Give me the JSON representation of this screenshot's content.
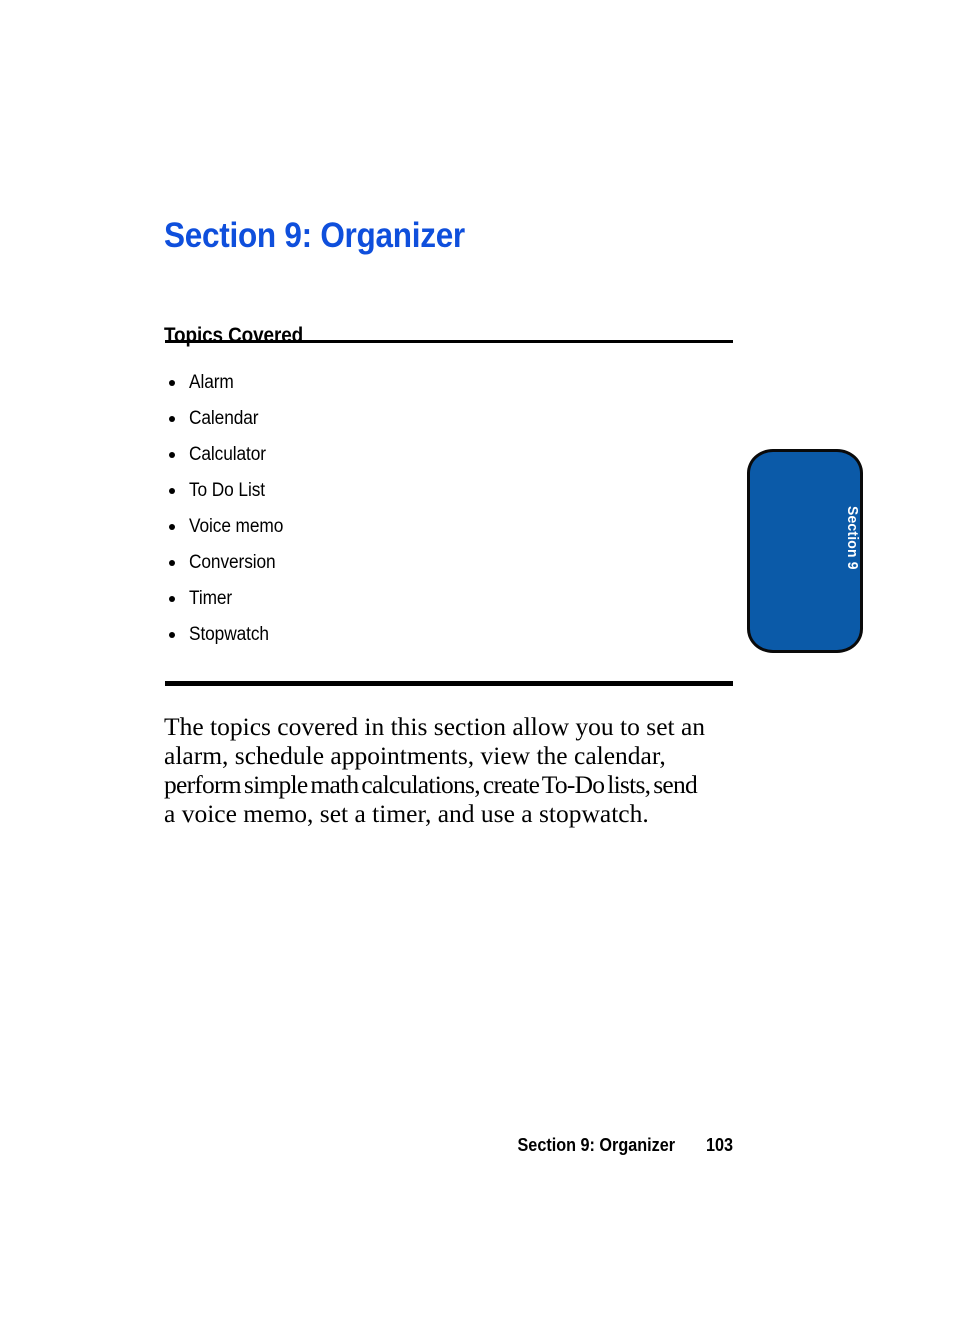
{
  "document": {
    "section_title": "Section 9: Organizer",
    "topics_heading": "Topics Covered",
    "topics": [
      {
        "label": "Alarm"
      },
      {
        "label": "Calendar"
      },
      {
        "label": "Calculator"
      },
      {
        "label": "To Do List"
      },
      {
        "label": "Voice memo"
      },
      {
        "label": "Conversion"
      },
      {
        "label": "Timer"
      },
      {
        "label": "Stopwatch"
      }
    ],
    "body": {
      "line1": "The topics covered in this section allow you to set an",
      "line2": "alarm, schedule appointments, view the calendar,",
      "line3": "perform simple math calculations, create To-Do lists, send",
      "line4": "a voice memo, set a timer, and use a stopwatch."
    },
    "side_tab": {
      "label": "Section 9"
    },
    "footer": {
      "title": "Section 9: Organizer",
      "page_number": "103"
    },
    "colors": {
      "title_blue": "#0f4fdc",
      "tab_blue": "#0b5aa8",
      "tab_border": "#0a0a0a",
      "text_black": "#000000",
      "page_background": "#ffffff"
    }
  }
}
